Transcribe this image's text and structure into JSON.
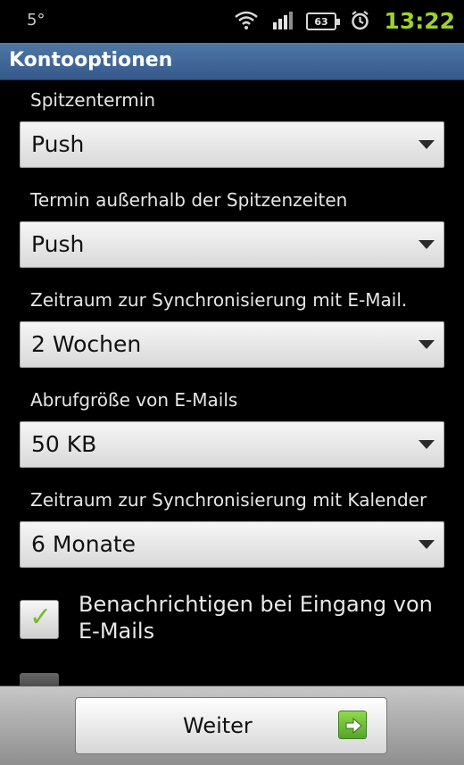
{
  "status_bar": {
    "temperature": "5°",
    "battery": "63",
    "time": "13:22",
    "icons": [
      "wifi-icon",
      "signal-icon",
      "battery-icon",
      "alarm-clock-icon"
    ]
  },
  "title_bar": {
    "title": "Kontooptionen"
  },
  "settings": [
    {
      "label": "Spitzentermin",
      "value": "Push"
    },
    {
      "label": "Termin außerhalb der Spitzenzeiten",
      "value": "Push"
    },
    {
      "label": "Zeitraum zur Synchronisierung mit E-Mail.",
      "value": "2 Wochen"
    },
    {
      "label": "Abrufgröße von E-Mails",
      "value": "50 KB"
    },
    {
      "label": "Zeitraum zur Synchronisierung mit Kalender",
      "value": "6 Monate"
    }
  ],
  "checkbox": {
    "label": "Benachrichtigen bei Eingang von E-Mails",
    "checked": true
  },
  "bottom_bar": {
    "next_label": "Weiter",
    "next_icon": "arrow-right-icon"
  },
  "colors": {
    "title_bar": "#3f679a",
    "time": "#9ed12b",
    "checkmark": "#79b82c",
    "next_icon": "#6cbf37"
  }
}
